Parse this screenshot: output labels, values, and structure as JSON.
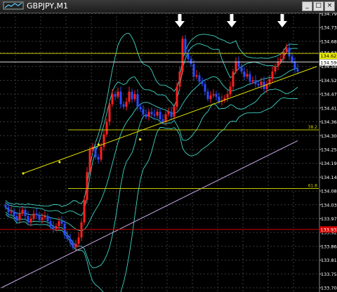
{
  "window": {
    "title": "GBPJPY,M1",
    "minimize_glyph": "_",
    "maximize_glyph": "□",
    "close_glyph": "×"
  },
  "colors": {
    "background": "#000000",
    "grid": "#3a3a3a",
    "bull_candle": "#ff2020",
    "bear_candle": "#2a4cff",
    "bands": "#3fd2c3",
    "trendline": "#e8e800",
    "fib_lines": "#c9c900",
    "long_ma": "#c9a7e6",
    "price_axis_text": "#ffffff",
    "arrows": "#ffffff",
    "red_level": "#d40000",
    "label_boxes": "#ffffff"
  },
  "chart_data": {
    "type": "candlestick",
    "symbol": "GBPJPY",
    "timeframe": "M1",
    "ylim": [
      133.7,
      134.79
    ],
    "y_ticks": [
      "134.790",
      "134.735",
      "134.680",
      "134.635",
      "134.580",
      "134.525",
      "134.470",
      "134.415",
      "134.360",
      "134.305",
      "134.250",
      "134.195",
      "134.140",
      "134.085",
      "134.030",
      "133.975",
      "133.920",
      "133.865",
      "133.810",
      "133.755",
      "133.700"
    ],
    "price_labels": [
      {
        "text": "134.622",
        "value": 134.622,
        "style": "yellow-box"
      },
      {
        "text": "134.596",
        "value": 134.596,
        "style": "white-box"
      },
      {
        "text": "133.932",
        "value": 133.932,
        "style": "red-box"
      }
    ],
    "horizontal_levels": [
      {
        "label": "",
        "value": 134.632,
        "color": "yellow"
      },
      {
        "label": "",
        "value": 134.598,
        "color": "white"
      },
      {
        "label": "38.2",
        "value": 134.328,
        "color": "yellow"
      },
      {
        "label": "61.8",
        "value": 134.095,
        "color": "yellow"
      },
      {
        "label": "",
        "value": 133.932,
        "color": "red"
      }
    ],
    "trendline": {
      "from": [
        0,
        134.155
      ],
      "to": [
        113,
        134.58
      ],
      "points": [
        [
          0,
          134.155
        ],
        [
          14,
          134.2
        ],
        [
          29,
          134.27
        ],
        [
          45,
          134.29
        ]
      ]
    },
    "arrows_at_bars": [
      63,
      82,
      100
    ],
    "closes": [
      134.02,
      134.0,
      134.005,
      133.985,
      133.97,
      133.995,
      134.01,
      133.985,
      133.96,
      133.975,
      133.995,
      133.99,
      133.97,
      133.98,
      133.985,
      133.965,
      133.945,
      133.935,
      133.945,
      133.965,
      133.955,
      133.91,
      133.895,
      133.88,
      133.86,
      133.875,
      133.9,
      133.96,
      134.05,
      134.16,
      134.25,
      134.26,
      134.22,
      134.21,
      134.26,
      134.31,
      134.36,
      134.43,
      134.47,
      134.46,
      134.48,
      134.43,
      134.42,
      134.44,
      134.48,
      134.45,
      134.47,
      134.42,
      134.41,
      134.39,
      134.38,
      134.4,
      134.39,
      134.385,
      134.4,
      134.37,
      134.36,
      134.39,
      134.4,
      134.38,
      134.42,
      134.5,
      134.56,
      134.69,
      134.63,
      134.61,
      134.59,
      134.54,
      134.545,
      134.52,
      134.51,
      134.48,
      134.45,
      134.465,
      134.47,
      134.46,
      134.44,
      134.445,
      134.455,
      134.47,
      134.5,
      134.56,
      134.6,
      134.58,
      134.56,
      134.54,
      134.55,
      134.52,
      134.525,
      134.51,
      134.505,
      134.52,
      134.49,
      134.51,
      134.53,
      134.56,
      134.58,
      134.6,
      134.61,
      134.64,
      134.655,
      134.62,
      134.6,
      134.57,
      134.56
    ],
    "ma_long": {
      "start_bar": 6,
      "start_value": 133.72,
      "end_bar": 104,
      "end_value": 134.285
    }
  }
}
